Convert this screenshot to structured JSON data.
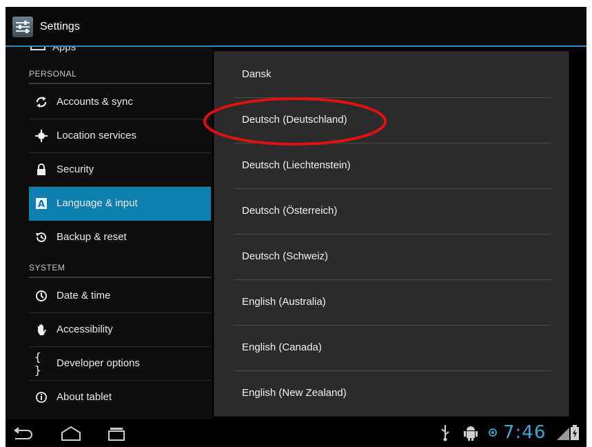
{
  "action_bar": {
    "title": "Settings",
    "app_icon": "settings-icon"
  },
  "sidebar": {
    "partial_item": "Apps",
    "personal_header": "PERSONAL",
    "personal_items": [
      {
        "label": "Accounts & sync",
        "icon": "sync-icon"
      },
      {
        "label": "Location services",
        "icon": "location-icon"
      },
      {
        "label": "Security",
        "icon": "lock-icon"
      },
      {
        "label": "Language & input",
        "icon": "keyboard-a-icon",
        "selected": true
      },
      {
        "label": "Backup & reset",
        "icon": "backup-icon"
      }
    ],
    "system_header": "SYSTEM",
    "system_items": [
      {
        "label": "Date & time",
        "icon": "clock-icon"
      },
      {
        "label": "Accessibility",
        "icon": "hand-icon"
      },
      {
        "label": "Developer options",
        "icon": "braces-icon"
      },
      {
        "label": "About tablet",
        "icon": "info-icon"
      }
    ]
  },
  "language_dialog": {
    "options": [
      "Dansk",
      "Deutsch (Deutschland)",
      "Deutsch (Liechtenstein)",
      "Deutsch (Österreich)",
      "Deutsch (Schweiz)",
      "English (Australia)",
      "English (Canada)",
      "English (New Zealand)"
    ],
    "highlighted_option": "Deutsch (Deutschland)",
    "highlight_color": "#e01010"
  },
  "status_bar": {
    "time": "7:46",
    "icons": [
      "usb-icon",
      "android-debug-icon",
      "sync-status-icon",
      "signal-icon",
      "battery-icon"
    ]
  },
  "nav_bar": {
    "buttons": [
      "back-button",
      "home-button",
      "recent-apps-button"
    ]
  },
  "colors": {
    "accent": "#0f7fb0",
    "clock": "#3aa7d6",
    "dialog_bg": "#2b2b2b"
  }
}
